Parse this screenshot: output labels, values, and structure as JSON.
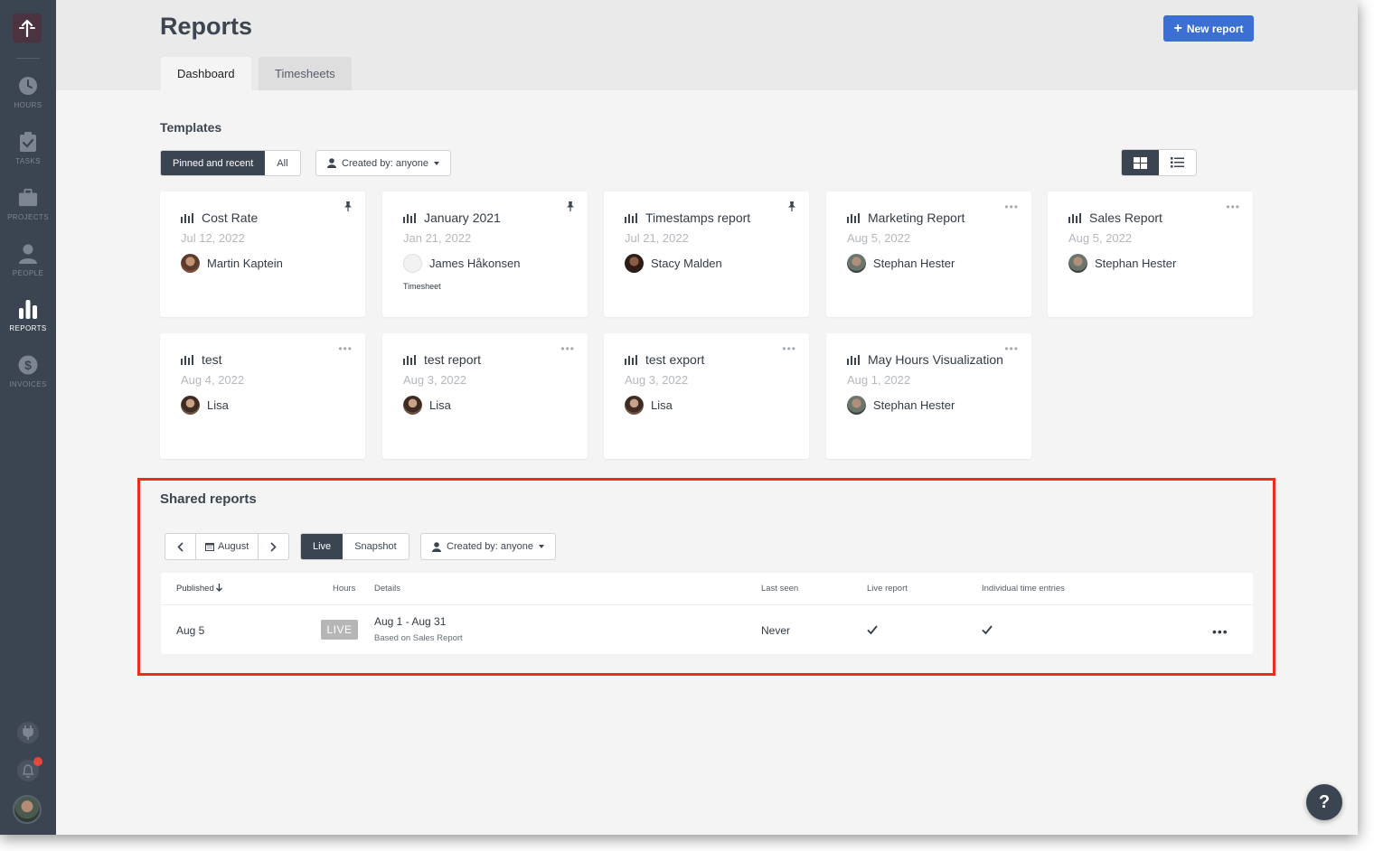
{
  "sidebar": {
    "logo_icon": "person-arrow-logo",
    "items": [
      {
        "label": "HOURS",
        "icon": "clock-icon"
      },
      {
        "label": "TASKS",
        "icon": "clipboard-check-icon"
      },
      {
        "label": "PROJECTS",
        "icon": "briefcase-icon"
      },
      {
        "label": "PEOPLE",
        "icon": "person-icon"
      },
      {
        "label": "REPORTS",
        "icon": "bar-chart-icon",
        "active": true
      },
      {
        "label": "INVOICES",
        "icon": "dollar-icon"
      }
    ],
    "bottom": [
      "plug-icon",
      "bell-icon",
      "avatar"
    ]
  },
  "header": {
    "title": "Reports",
    "new_report_label": "New report",
    "tabs": [
      {
        "label": "Dashboard",
        "active": true
      },
      {
        "label": "Timesheets",
        "active": false
      }
    ]
  },
  "templates": {
    "title": "Templates",
    "filters": {
      "pinned_label": "Pinned and recent",
      "all_label": "All",
      "created_by_label": "Created by: anyone"
    },
    "cards": [
      {
        "name": "Cost Rate",
        "date": "Jul 12, 2022",
        "user": "Martin Kaptein",
        "pinned": true
      },
      {
        "name": "January 2021",
        "date": "Jan 21, 2022",
        "user": "James Håkonsen",
        "tag": "Timesheet",
        "pinned": true
      },
      {
        "name": "Timestamps report",
        "date": "Jul 21, 2022",
        "user": "Stacy Malden",
        "pinned": true
      },
      {
        "name": "Marketing Report",
        "date": "Aug 5, 2022",
        "user": "Stephan Hester",
        "pinned": false
      },
      {
        "name": "Sales Report",
        "date": "Aug 5, 2022",
        "user": "Stephan Hester",
        "pinned": false
      },
      {
        "name": "test",
        "date": "Aug 4, 2022",
        "user": "Lisa",
        "pinned": false
      },
      {
        "name": "test report",
        "date": "Aug 3, 2022",
        "user": "Lisa",
        "pinned": false
      },
      {
        "name": "test export",
        "date": "Aug 3, 2022",
        "user": "Lisa",
        "pinned": false
      },
      {
        "name": "May Hours Visualization",
        "date": "Aug 1, 2022",
        "user": "Stephan Hester",
        "pinned": false
      }
    ]
  },
  "shared": {
    "title": "Shared reports",
    "month_label": "August",
    "live_label": "Live",
    "snapshot_label": "Snapshot",
    "created_by_label": "Created by: anyone",
    "columns": {
      "published": "Published",
      "hours": "Hours",
      "details": "Details",
      "last_seen": "Last seen",
      "live_report": "Live report",
      "individual_time_entries": "Individual time entries"
    },
    "rows": [
      {
        "published": "Aug 5",
        "badge": "LIVE",
        "details_range": "Aug 1 - Aug 31",
        "details_source": "Based on Sales Report",
        "last_seen": "Never",
        "live_report": true,
        "individual_time_entries": true
      }
    ]
  },
  "help_label": "?",
  "colors": {
    "sidebar": "#3b4451",
    "primary_button": "#3b6fd4",
    "highlight_border": "#ee2b1d",
    "notification_dot": "#e8473c"
  }
}
